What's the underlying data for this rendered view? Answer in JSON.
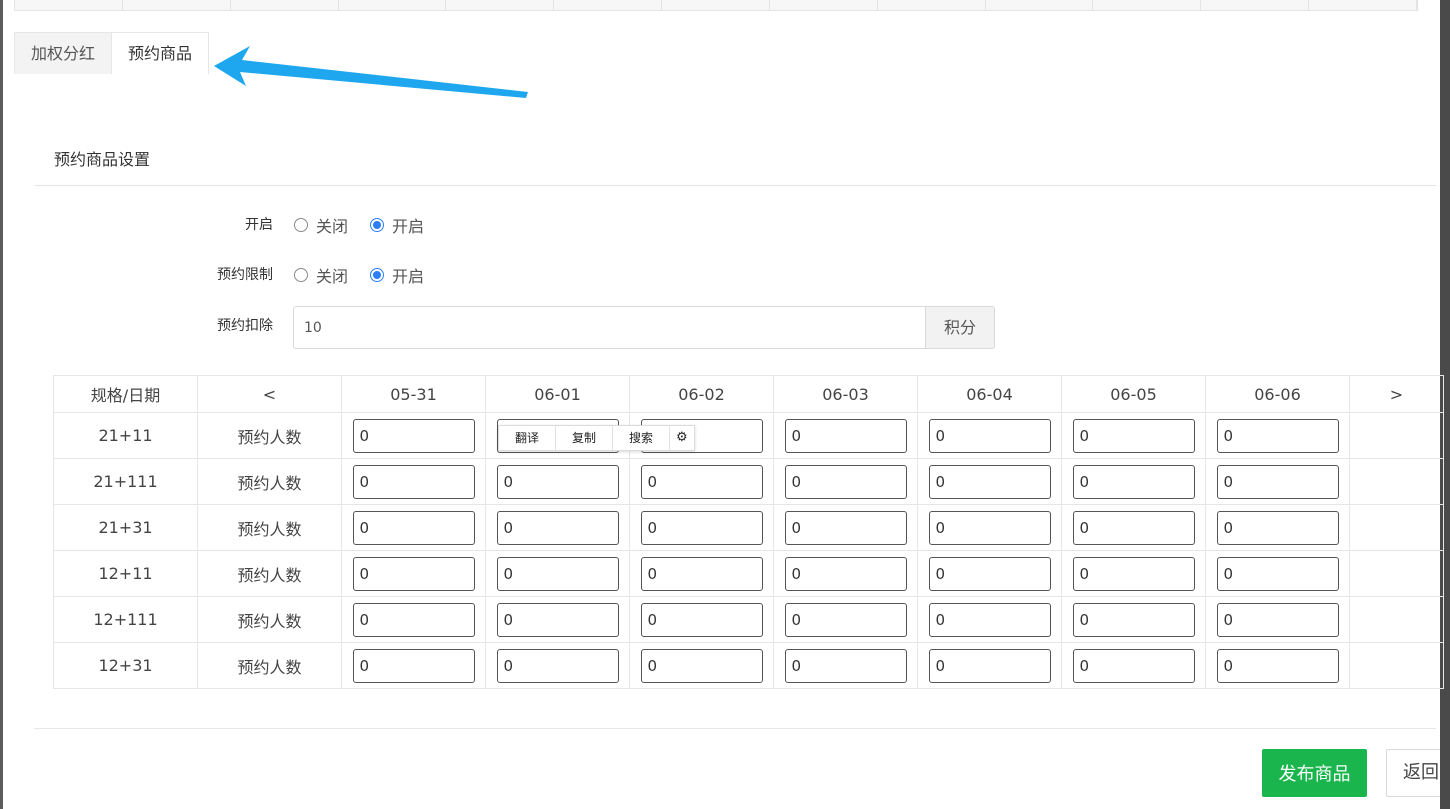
{
  "tabs": [
    {
      "label": "加权分红",
      "active": false
    },
    {
      "label": "预约商品",
      "active": true
    }
  ],
  "section": {
    "title": "预约商品设置"
  },
  "form": {
    "enable": {
      "label": "开启",
      "options": [
        "关闭",
        "开启"
      ],
      "selected": "开启"
    },
    "limit": {
      "label": "预约限制",
      "options": [
        "关闭",
        "开启"
      ],
      "selected": "开启"
    },
    "deduct": {
      "label": "预约扣除",
      "value": "10",
      "addon": "积分"
    }
  },
  "table": {
    "corner_header": "规格/日期",
    "prev": "<",
    "next": ">",
    "dates": [
      "05-31",
      "06-01",
      "06-02",
      "06-03",
      "06-04",
      "06-05",
      "06-06"
    ],
    "rows": [
      {
        "spec": "21+11",
        "label": "预约人数",
        "values": [
          "0",
          "0",
          "0",
          "0",
          "0",
          "0",
          "0"
        ]
      },
      {
        "spec": "21+111",
        "label": "预约人数",
        "values": [
          "0",
          "0",
          "0",
          "0",
          "0",
          "0",
          "0"
        ]
      },
      {
        "spec": "21+31",
        "label": "预约人数",
        "values": [
          "0",
          "0",
          "0",
          "0",
          "0",
          "0",
          "0"
        ]
      },
      {
        "spec": "12+11",
        "label": "预约人数",
        "values": [
          "0",
          "0",
          "0",
          "0",
          "0",
          "0",
          "0"
        ]
      },
      {
        "spec": "12+111",
        "label": "预约人数",
        "values": [
          "0",
          "0",
          "0",
          "0",
          "0",
          "0",
          "0"
        ]
      },
      {
        "spec": "12+31",
        "label": "预约人数",
        "values": [
          "0",
          "0",
          "0",
          "0",
          "0",
          "0",
          "0"
        ]
      }
    ]
  },
  "popup": {
    "translate": "翻译",
    "copy": "复制",
    "search": "搜索",
    "gear": "⚙"
  },
  "footer": {
    "publish": "发布商品",
    "back": "返回"
  },
  "colors": {
    "primary": "#1ab64d",
    "radio": "#2d7ff9",
    "arrow": "#1ea7ef"
  }
}
